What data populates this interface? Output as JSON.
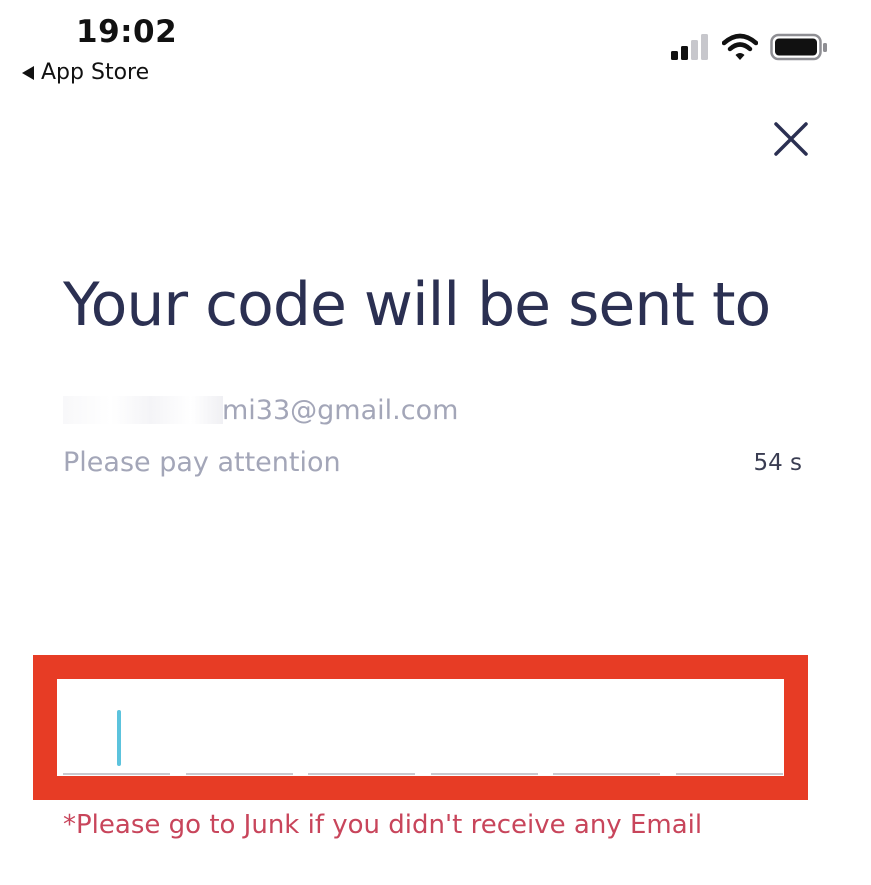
{
  "status_bar": {
    "time": "19:02",
    "back_label": "App Store",
    "icons": [
      "cellular-signal-icon",
      "wifi-icon",
      "battery-icon"
    ]
  },
  "header": {
    "close_icon": "close-icon"
  },
  "main": {
    "title": "Your code will be sent to",
    "email_visible_suffix": "mi33@gmail.com",
    "hint": "Please pay attention",
    "countdown": "54 s",
    "code_length": 6,
    "code_value": "",
    "junk_note": "*Please go to Junk if you didn't receive any Email"
  },
  "colors": {
    "title": "#2b3052",
    "muted": "#a3a6b8",
    "highlight": "#e73c25",
    "caret": "#5cc3dd",
    "note": "#c8455b"
  }
}
